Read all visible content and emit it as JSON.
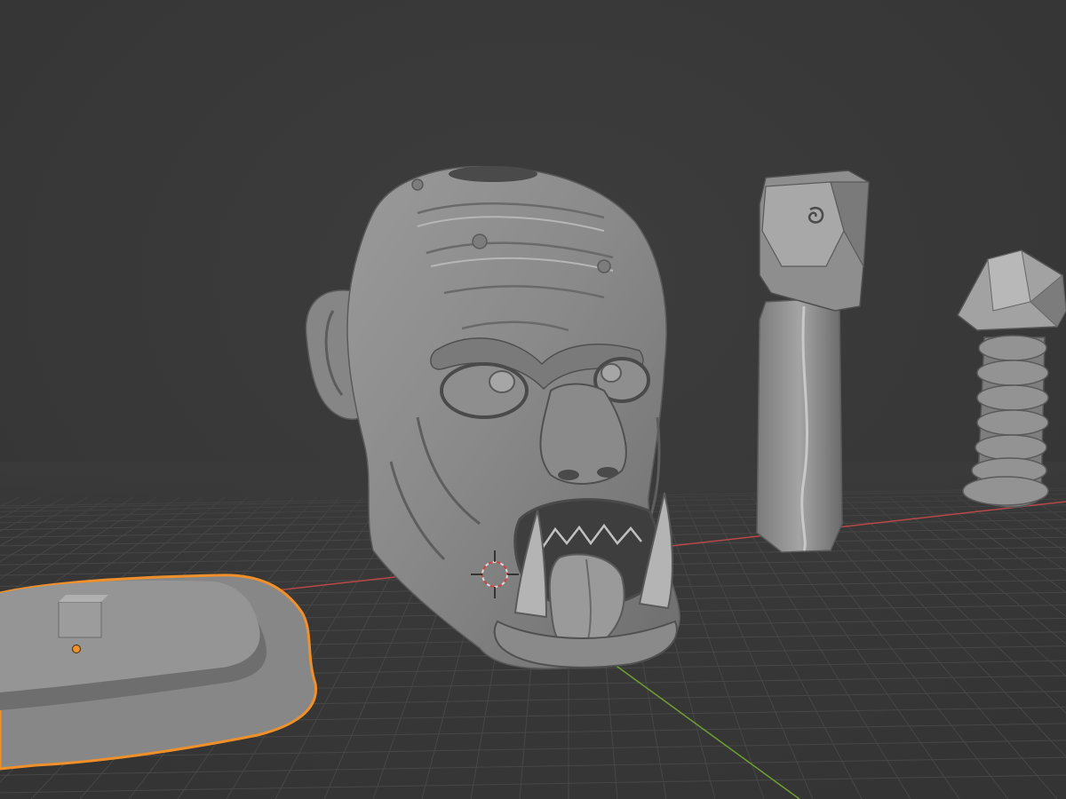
{
  "viewport": {
    "background_color": "#3a3a3a",
    "grid_color": "#464646",
    "x_axis_color": "#b84848",
    "y_axis_color": "#6ea030",
    "selection_outline_color": "#f0902a",
    "origin_dot_color": "#f0902a",
    "mesh_color": "#8c8c8c",
    "mesh_highlight_color": "#c8c8c8",
    "mesh_shadow_color": "#555555"
  },
  "objects": [
    {
      "name": "orc-head-sculpt",
      "selected": false
    },
    {
      "name": "stone-pillar",
      "selected": false
    },
    {
      "name": "segmented-post",
      "selected": false
    },
    {
      "name": "ground-slab",
      "selected": true
    }
  ],
  "cursor": {
    "icon": "3d-cursor-icon"
  }
}
